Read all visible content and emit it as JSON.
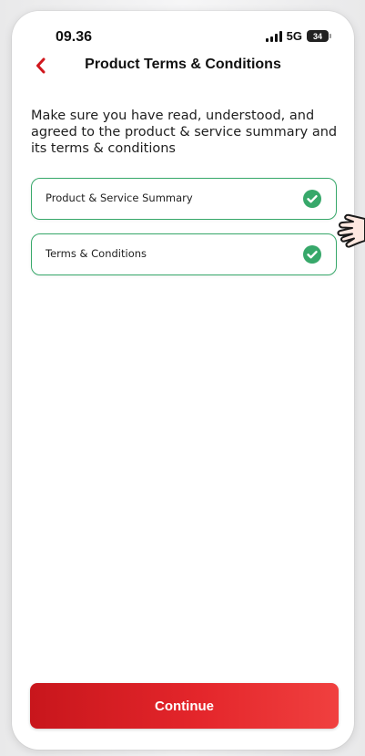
{
  "status_bar": {
    "time": "09.36",
    "network": "5G",
    "battery": "34"
  },
  "header": {
    "title": "Product Terms & Conditions",
    "back_icon": "chevron-left-icon"
  },
  "intro": {
    "text": "Make sure you have read, understood, and agreed to the product & service summary and its terms & conditions"
  },
  "documents": [
    {
      "label": "Product & Service Summary",
      "status_icon": "check-circle-icon",
      "checked": true
    },
    {
      "label": "Terms & Conditions",
      "status_icon": "check-circle-icon",
      "checked": true
    }
  ],
  "footer": {
    "continue_label": "Continue"
  },
  "colors": {
    "accent_red": "#e4262b",
    "success_green": "#37a86a",
    "text_dark": "#1f1f1f"
  }
}
